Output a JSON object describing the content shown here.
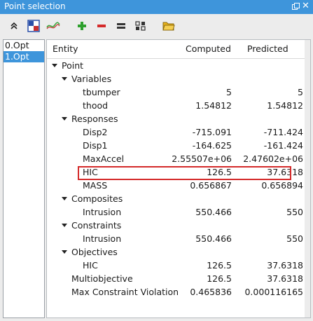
{
  "window": {
    "title": "Point selection"
  },
  "toolbar": {
    "buttons": [
      {
        "name": "collapse-all-icon",
        "color": "#222222"
      },
      {
        "name": "ls-logo-icon",
        "color": "#2a4fa8"
      },
      {
        "name": "curve-plot-icon",
        "color": "#3aa53a"
      },
      {
        "name": "add-icon",
        "color": "#2ea02e"
      },
      {
        "name": "remove-icon",
        "color": "#d42a2a"
      },
      {
        "name": "equal-icon",
        "color": "#333333"
      },
      {
        "name": "grid-select-icon",
        "color": "#333333"
      },
      {
        "name": "folder-open-icon",
        "color": "#e8b21a"
      }
    ]
  },
  "points_list": {
    "items": [
      {
        "label": "0.Opt",
        "selected": false
      },
      {
        "label": "1.Opt",
        "selected": true
      }
    ],
    "selection_color": "#3e95db"
  },
  "table": {
    "headers": {
      "entity": "Entity",
      "computed": "Computed",
      "predicted": "Predicted"
    },
    "rows": [
      {
        "name": "Point",
        "level": 0,
        "expandable": true,
        "computed": "",
        "predicted": ""
      },
      {
        "name": "Variables",
        "level": 1,
        "expandable": true,
        "computed": "",
        "predicted": ""
      },
      {
        "name": "tbumper",
        "level": 2,
        "expandable": false,
        "computed": "5",
        "predicted": "5"
      },
      {
        "name": "thood",
        "level": 2,
        "expandable": false,
        "computed": "1.54812",
        "predicted": "1.54812"
      },
      {
        "name": "Responses",
        "level": 1,
        "expandable": true,
        "computed": "",
        "predicted": ""
      },
      {
        "name": "Disp2",
        "level": 2,
        "expandable": false,
        "computed": "-715.091",
        "predicted": "-711.424"
      },
      {
        "name": "Disp1",
        "level": 2,
        "expandable": false,
        "computed": "-164.625",
        "predicted": "-161.424"
      },
      {
        "name": "MaxAccel",
        "level": 2,
        "expandable": false,
        "computed": "2.55507e+06",
        "predicted": "2.47602e+06"
      },
      {
        "name": "HIC",
        "level": 2,
        "expandable": false,
        "computed": "126.5",
        "predicted": "37.6318",
        "highlighted": true
      },
      {
        "name": "MASS",
        "level": 2,
        "expandable": false,
        "computed": "0.656867",
        "predicted": "0.656894"
      },
      {
        "name": "Composites",
        "level": 1,
        "expandable": true,
        "computed": "",
        "predicted": ""
      },
      {
        "name": "Intrusion",
        "level": 2,
        "expandable": false,
        "computed": "550.466",
        "predicted": "550"
      },
      {
        "name": "Constraints",
        "level": 1,
        "expandable": true,
        "computed": "",
        "predicted": ""
      },
      {
        "name": "Intrusion",
        "level": 2,
        "expandable": false,
        "computed": "550.466",
        "predicted": "550"
      },
      {
        "name": "Objectives",
        "level": 1,
        "expandable": true,
        "computed": "",
        "predicted": ""
      },
      {
        "name": "HIC",
        "level": 2,
        "expandable": false,
        "computed": "126.5",
        "predicted": "37.6318"
      },
      {
        "name": "Multiobjective",
        "level": 1,
        "expandable": false,
        "computed": "126.5",
        "predicted": "37.6318"
      },
      {
        "name": "Max Constraint Violation",
        "level": 1,
        "expandable": false,
        "computed": "0.465836",
        "predicted": "0.000116165"
      }
    ],
    "highlight_color": "#d42a2a"
  }
}
